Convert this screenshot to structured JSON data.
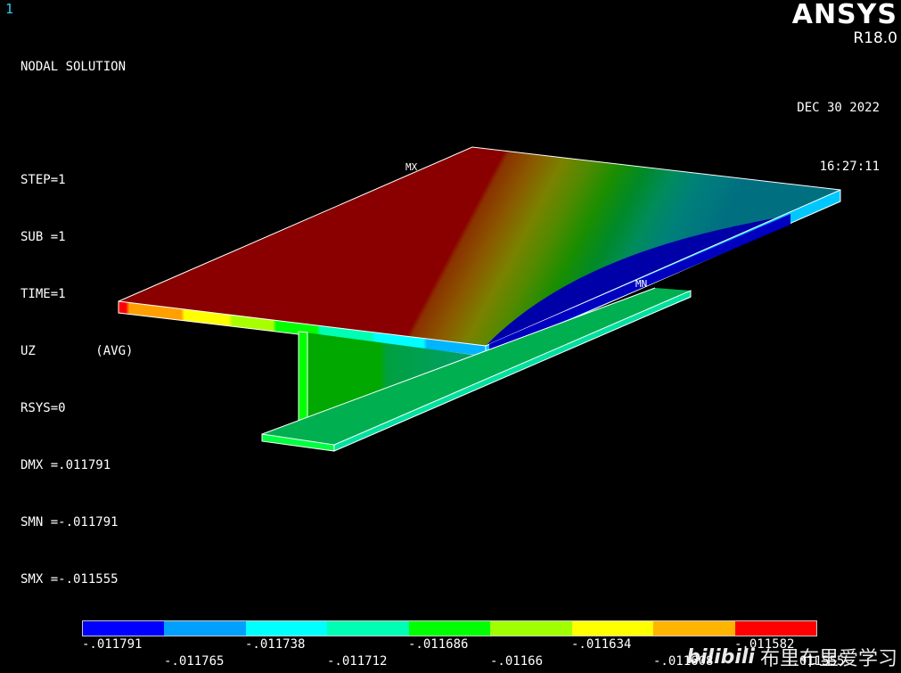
{
  "window": {
    "number": "1"
  },
  "info": {
    "lines": [
      "NODAL SOLUTION",
      "",
      "STEP=1",
      "SUB =1",
      "TIME=1",
      "UZ        (AVG)",
      "RSYS=0",
      "DMX =.011791",
      "SMN =-.011791",
      "SMX =-.011555"
    ]
  },
  "brand": {
    "name": "ANSYS",
    "version": "R18.0"
  },
  "datetime": {
    "date": "DEC 30 2022",
    "time": "16:27:11"
  },
  "markers": {
    "max": "MX",
    "min": "MN"
  },
  "legend": {
    "colors": [
      "#0000ff",
      "#00a0ff",
      "#00ffff",
      "#00ffb4",
      "#00ff00",
      "#a0ff00",
      "#ffff00",
      "#ffb400",
      "#ff0000"
    ],
    "labels_top": [
      "-.011791",
      "-.011738",
      "-.011686",
      "-.011634",
      "-.011582"
    ],
    "labels_bottom": [
      "-.011765",
      "-.011712",
      "-.01166",
      "-.011608",
      "-.011555"
    ]
  },
  "watermark": {
    "logo": "bilibili",
    "text": "布里布里爱学习"
  }
}
